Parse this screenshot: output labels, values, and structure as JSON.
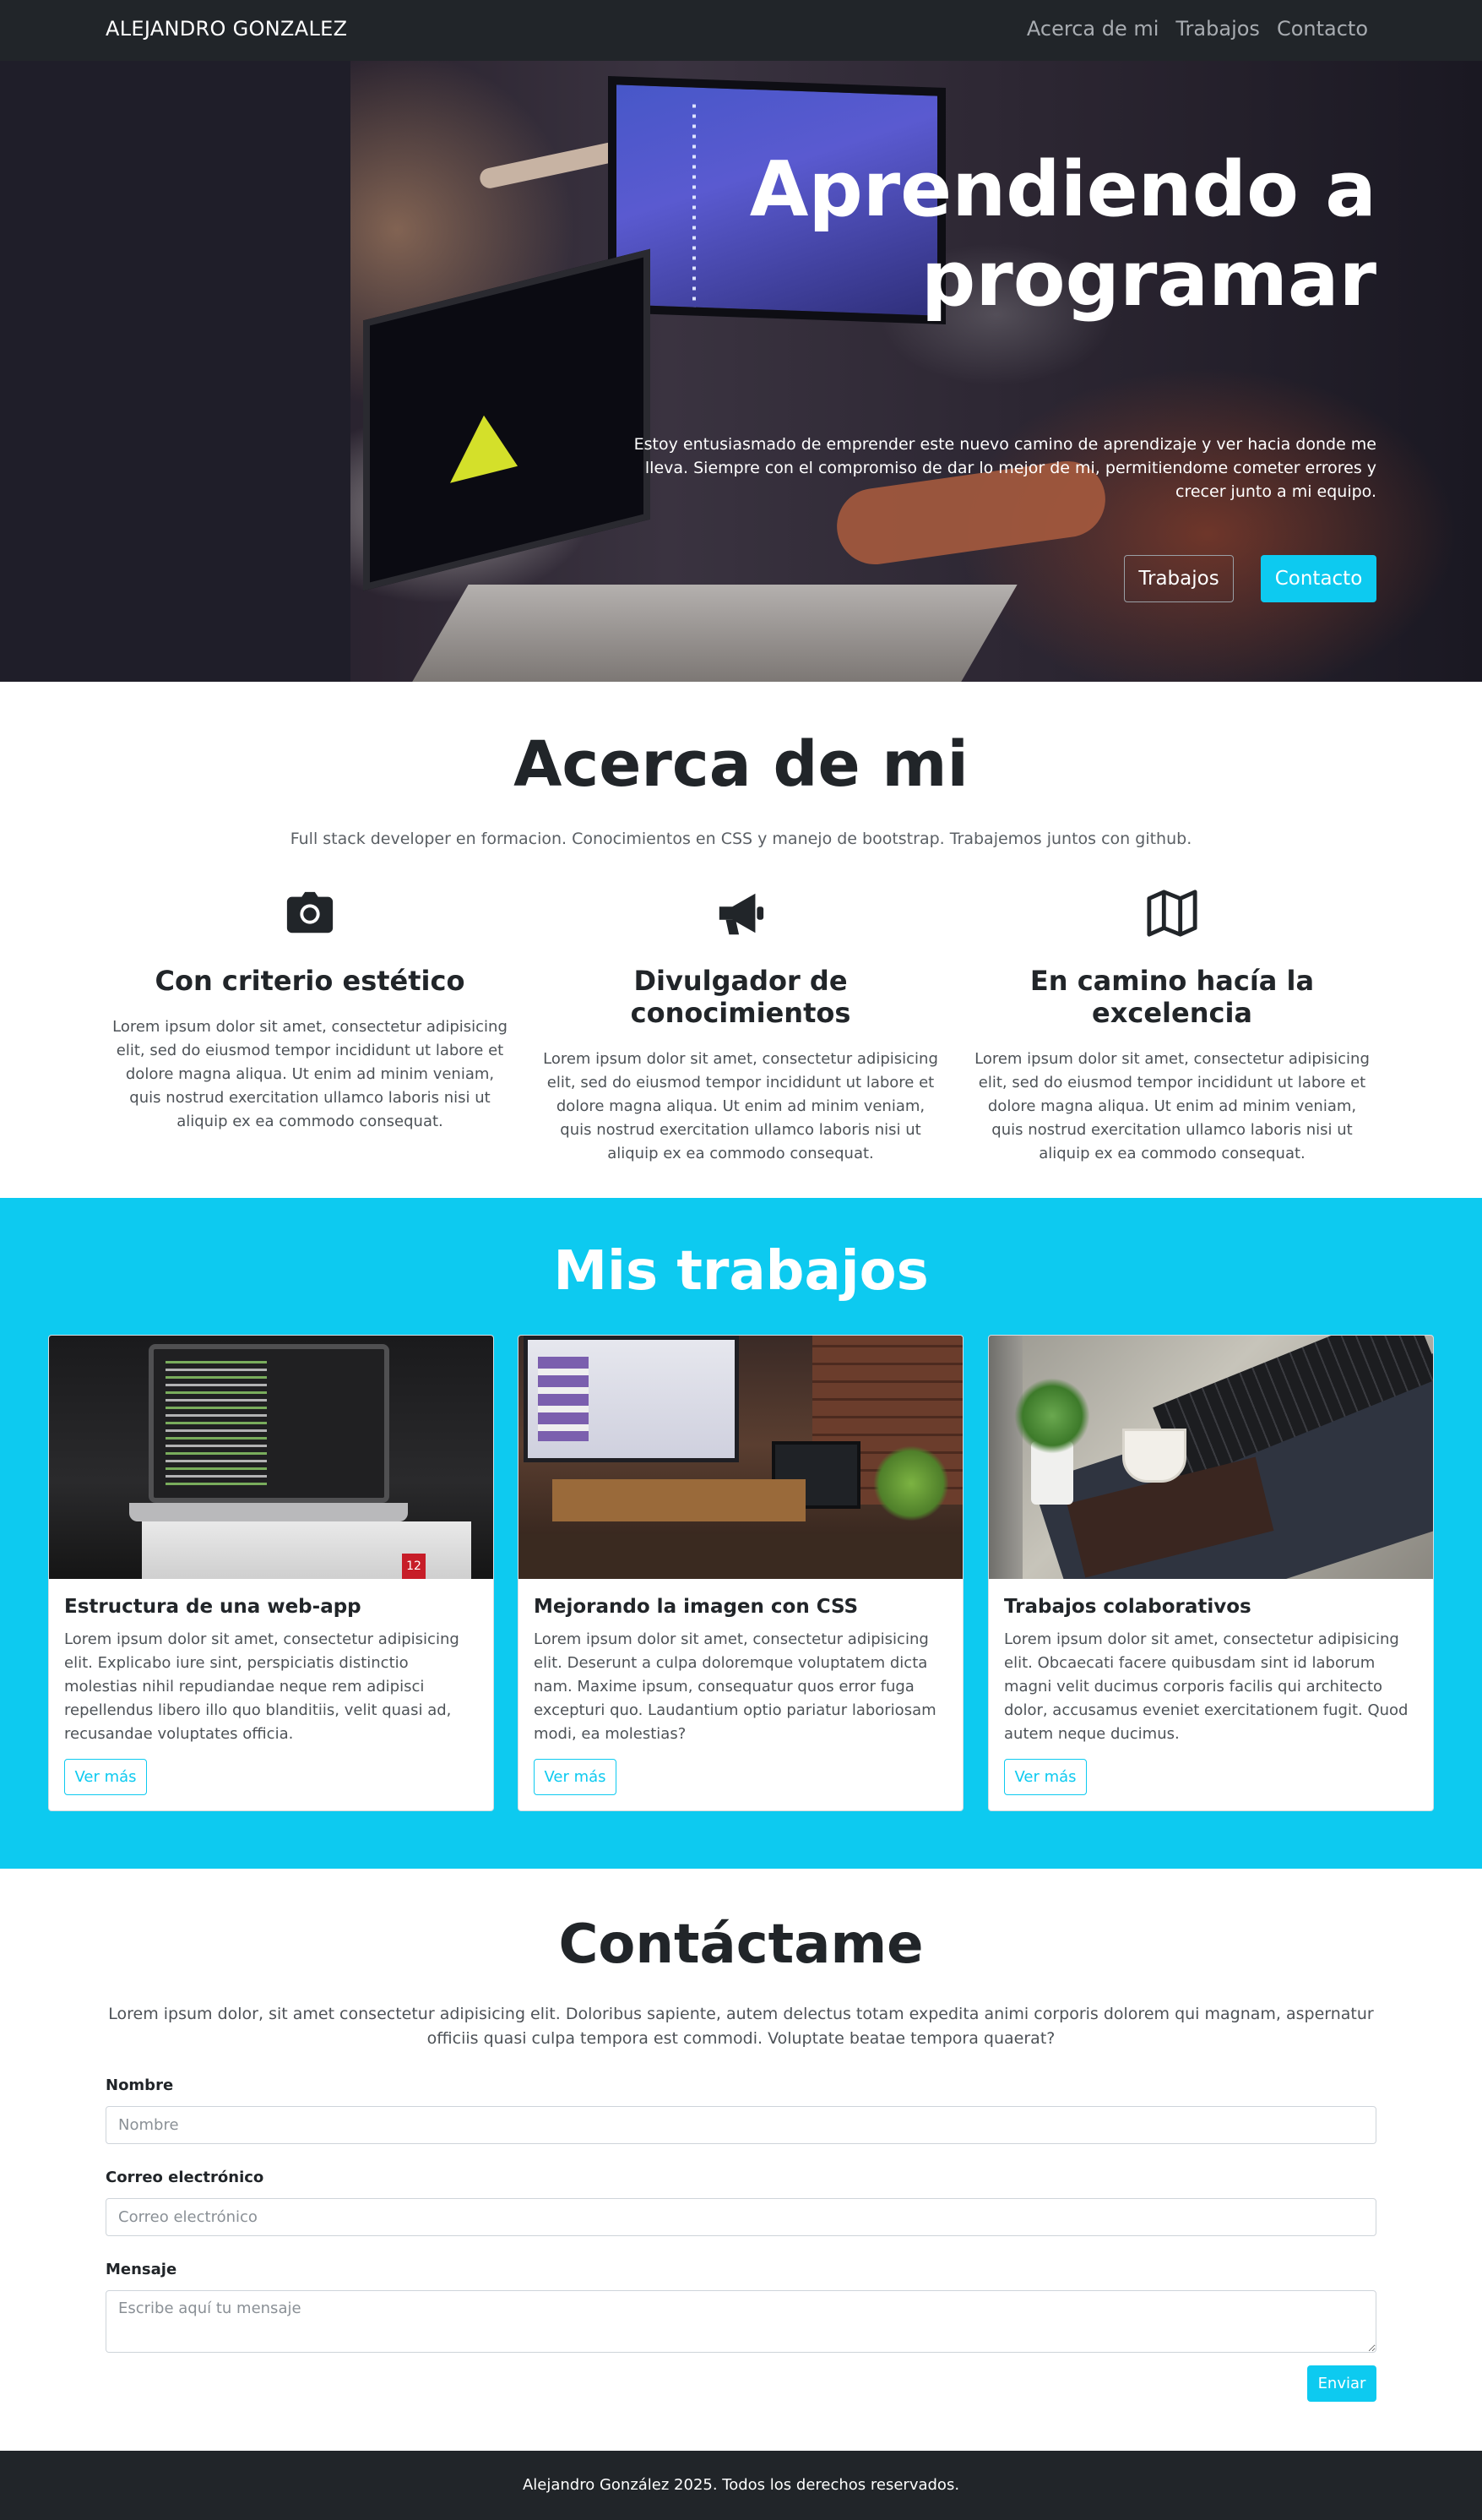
{
  "navbar": {
    "brand": "ALEJANDRO GONZALEZ",
    "links": [
      "Acerca de mi",
      "Trabajos",
      "Contacto"
    ]
  },
  "hero": {
    "title": "Aprendiendo a programar",
    "text": "Estoy entusiasmado de emprender este nuevo camino de aprendizaje y ver hacia donde me lleva. Siempre con el compromiso de dar lo mejor de mi, permitiendome cometer errores y crecer junto a mi equipo.",
    "btn_works": "Trabajos",
    "btn_contact": "Contacto"
  },
  "about": {
    "title": "Acerca de mi",
    "lead": "Full stack developer en formacion. Conocimientos en CSS y manejo de bootstrap. Trabajemos juntos con github.",
    "features": [
      {
        "icon": "camera-icon",
        "title": "Con criterio estético",
        "text": "Lorem ipsum dolor sit amet, consectetur adipisicing elit, sed do eiusmod tempor incididunt ut labore et dolore magna aliqua. Ut enim ad minim veniam, quis nostrud exercitation ullamco laboris nisi ut aliquip ex ea commodo consequat."
      },
      {
        "icon": "megaphone-icon",
        "title": "Divulgador de conocimientos",
        "text": "Lorem ipsum dolor sit amet, consectetur adipisicing elit, sed do eiusmod tempor incididunt ut labore et dolore magna aliqua. Ut enim ad minim veniam, quis nostrud exercitation ullamco laboris nisi ut aliquip ex ea commodo consequat."
      },
      {
        "icon": "map-icon",
        "title": "En camino hacía la excelencia",
        "text": "Lorem ipsum dolor sit amet, consectetur adipisicing elit, sed do eiusmod tempor incididunt ut labore et dolore magna aliqua. Ut enim ad minim veniam, quis nostrud exercitation ullamco laboris nisi ut aliquip ex ea commodo consequat."
      }
    ]
  },
  "works": {
    "title": "Mis trabajos",
    "cards": [
      {
        "title": "Estructura de una web-app",
        "text": "Lorem ipsum dolor sit amet, consectetur adipisicing elit. Explicabo iure sint, perspiciatis distinctio molestias nihil repudiandae neque rem adipisci repellendus libero illo quo blanditiis, velit quasi ad, recusandae voluptates officia.",
        "button": "Ver más",
        "image_tag": "12"
      },
      {
        "title": "Mejorando la imagen con CSS",
        "text": "Lorem ipsum dolor sit amet, consectetur adipisicing elit. Deserunt a culpa doloremque voluptatem dicta nam. Maxime ipsum, consequatur quos error fuga excepturi quo. Laudantium optio pariatur laboriosam modi, ea molestias?",
        "button": "Ver más"
      },
      {
        "title": "Trabajos colaborativos",
        "text": "Lorem ipsum dolor sit amet, consectetur adipisicing elit. Obcaecati facere quibusdam sint id laborum magni velit ducimus corporis facilis qui architecto dolor, accusamus eveniet exercitationem fugit. Quod autem neque ducimus.",
        "button": "Ver más"
      }
    ]
  },
  "contact": {
    "title": "Contáctame",
    "lead": "Lorem ipsum dolor, sit amet consectetur adipisicing elit. Doloribus sapiente, autem delectus totam expedita animi corporis dolorem qui magnam, aspernatur officiis quasi culpa tempora est commodi. Voluptate beatae tempora quaerat?",
    "name_label": "Nombre",
    "name_placeholder": "Nombre",
    "name_value": "",
    "email_label": "Correo electrónico",
    "email_placeholder": "Correo electrónico",
    "email_value": "",
    "message_label": "Mensaje",
    "message_placeholder": "Escribe aquí tu mensaje",
    "message_value": "",
    "submit": "Enviar"
  },
  "footer": {
    "text": "Alejandro González 2025. Todos los derechos reservados."
  },
  "colors": {
    "dark": "#212529",
    "accent": "#0dcaf0",
    "white": "#ffffff"
  }
}
